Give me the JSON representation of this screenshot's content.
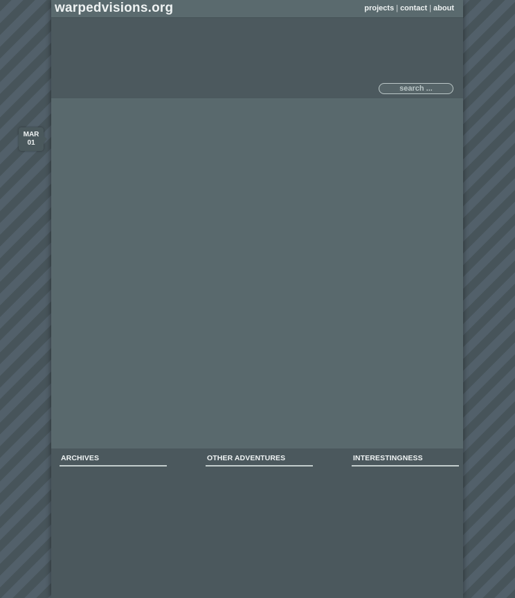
{
  "site": {
    "title": "warpedvisions.org"
  },
  "nav": {
    "items": [
      "projects",
      "contact",
      "about"
    ],
    "separator": "|"
  },
  "search": {
    "placeholder": "search ..."
  },
  "post": {
    "month": "MAR",
    "day": "01"
  },
  "footer": {
    "columns": [
      "ARCHIVES",
      "OTHER ADVENTURES",
      "INTERESTINGNESS"
    ]
  },
  "colors": {
    "background_stripe_dark": "#47545a",
    "background_stripe_light": "#52606a",
    "page": "#4b595e",
    "content": "#59696d",
    "text": "#eef2f2"
  }
}
